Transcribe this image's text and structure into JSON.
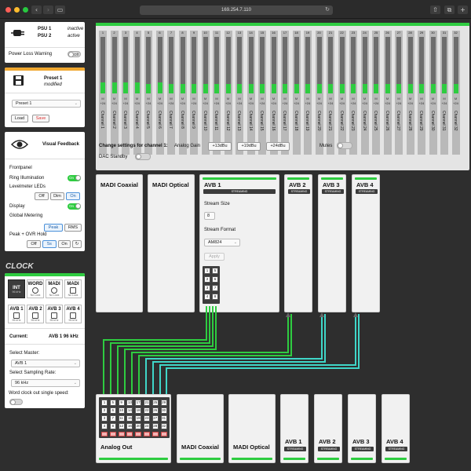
{
  "browser": {
    "url": "169.254.7.110"
  },
  "psu": {
    "items": [
      {
        "label": "PSU 1",
        "status": "inactive"
      },
      {
        "label": "PSU 2",
        "status": "active"
      }
    ],
    "power_loss_label": "Power Loss Warning",
    "power_loss_toggle": "Off"
  },
  "preset": {
    "name": "Preset 1",
    "status": "modified",
    "select_value": "Preset 1",
    "load_label": "Load",
    "save_label": "Save"
  },
  "visual_feedback": {
    "title": "Visual Feedback",
    "frontpanel_label": "Frontpanel",
    "ring_label": "Ring Illumination",
    "ring_toggle": "On",
    "levelmeter_label": "Levelmeter LEDs",
    "levelmeter_options": [
      "Off",
      "Dim",
      "On"
    ],
    "display_label": "Display",
    "display_toggle": "On",
    "global_metering_label": "Global Metering",
    "metering_options": [
      "Peak",
      "RMS"
    ],
    "peak_hold_label": "Peak + OVR Hold",
    "peak_hold_options": [
      "Off",
      "5s",
      "On",
      "↻"
    ]
  },
  "clock": {
    "title": "CLOCK",
    "sources_top": [
      {
        "name": "INT",
        "status": "96 kHz"
      },
      {
        "name": "WORD",
        "status": "No Lock"
      },
      {
        "name": "MADI",
        "status": "No Lock"
      },
      {
        "name": "MADI",
        "status": "No Lock"
      }
    ],
    "sources_bottom": [
      {
        "name": "AVB 1",
        "status": "96 kHz"
      },
      {
        "name": "AVB 2",
        "status": "96 kHz"
      },
      {
        "name": "AVB 3",
        "status": "96 kHz"
      },
      {
        "name": "AVB 4",
        "status": "96 kHz"
      }
    ],
    "current_label": "Current:",
    "current_value": "AVB 1 96 kHz",
    "master_label": "Select Master:",
    "master_value": "AVB 1",
    "rate_label": "Select Sampling Rate:",
    "rate_value": "96 kHz",
    "wordclock_label": "Word clock out single speed:"
  },
  "mixer": {
    "channels": [
      {
        "num": "1",
        "gain": "+24",
        "name": "Channel 1"
      },
      {
        "num": "2",
        "gain": "+24",
        "name": "Channel 2"
      },
      {
        "num": "3",
        "gain": "+24",
        "name": "Channel 3"
      },
      {
        "num": "4",
        "gain": "+24",
        "name": "Channel 4"
      },
      {
        "num": "5",
        "gain": "+24",
        "name": "Channel 5"
      },
      {
        "num": "6",
        "gain": "+24",
        "name": "Channel 6"
      },
      {
        "num": "7",
        "gain": "+24",
        "name": "Channel 7"
      },
      {
        "num": "8",
        "gain": "+24",
        "name": "Channel 8"
      },
      {
        "num": "9",
        "gain": "+24",
        "name": "Channel 9"
      },
      {
        "num": "10",
        "gain": "+24",
        "name": "Channel 10"
      },
      {
        "num": "11",
        "gain": "+24",
        "name": "Channel 11"
      },
      {
        "num": "12",
        "gain": "+24",
        "name": "Channel 12"
      },
      {
        "num": "13",
        "gain": "+24",
        "name": "Channel 13"
      },
      {
        "num": "14",
        "gain": "+24",
        "name": "Channel 14"
      },
      {
        "num": "15",
        "gain": "+24",
        "name": "Channel 15"
      },
      {
        "num": "16",
        "gain": "+24",
        "name": "Channel 16"
      },
      {
        "num": "17",
        "gain": "+24",
        "name": "Channel 17"
      },
      {
        "num": "18",
        "gain": "+24",
        "name": "Channel 18"
      },
      {
        "num": "19",
        "gain": "+24",
        "name": "Channel 19"
      },
      {
        "num": "20",
        "gain": "+24",
        "name": "Channel 20"
      },
      {
        "num": "21",
        "gain": "+24",
        "name": "Channel 21"
      },
      {
        "num": "22",
        "gain": "+24",
        "name": "Channel 22"
      },
      {
        "num": "23",
        "gain": "+24",
        "name": "Channel 23"
      },
      {
        "num": "24",
        "gain": "+24",
        "name": "Channel 24"
      },
      {
        "num": "25",
        "gain": "+24",
        "name": "Channel 25"
      },
      {
        "num": "26",
        "gain": "+24",
        "name": "Channel 26"
      },
      {
        "num": "27",
        "gain": "+24",
        "name": "Channel 27"
      },
      {
        "num": "28",
        "gain": "+24",
        "name": "Channel 28"
      },
      {
        "num": "29",
        "gain": "+24",
        "name": "Channel 29"
      },
      {
        "num": "30",
        "gain": "+24",
        "name": "Channel 30"
      },
      {
        "num": "31",
        "gain": "+24",
        "name": "Channel 31"
      },
      {
        "num": "32",
        "gain": "+24",
        "name": "Channel 32"
      }
    ],
    "mute_marker": "M",
    "change_label": "Change settings for channel 1:",
    "analog_gain_label": "Analog Gain",
    "gain_options": [
      "+13dBu",
      "+19dBu",
      "+24dBu"
    ],
    "mutes_label": "Mutes",
    "dac_label": "DAC Standby"
  },
  "inputs": {
    "madi_coaxial": "MADI Coaxial",
    "madi_optical": "MADI Optical",
    "avb1": {
      "title": "AVB 1",
      "streaming": "STREAMING",
      "stream_size_label": "Stream Size",
      "stream_size_value": "8",
      "stream_format_label": "Stream Format",
      "stream_format_value": "AM824",
      "apply_label": "Apply",
      "slots": [
        "1",
        "5",
        "2",
        "6",
        "3",
        "7",
        "4",
        "8"
      ]
    },
    "avb2": {
      "title": "AVB 2",
      "streaming": "STREAMING"
    },
    "avb3": {
      "title": "AVB 3",
      "streaming": "STREAMING"
    },
    "avb4": {
      "title": "AVB 4",
      "streaming": "STREAMING"
    }
  },
  "outputs": {
    "analog_out": "Analog Out",
    "grid": [
      "1",
      "5",
      "9",
      "13",
      "17",
      "21",
      "25",
      "29",
      "2",
      "6",
      "10",
      "14",
      "18",
      "22",
      "26",
      "30",
      "3",
      "7",
      "11",
      "15",
      "19",
      "23",
      "27",
      "31",
      "4",
      "8",
      "12",
      "16",
      "20",
      "24",
      "28",
      "32"
    ],
    "madi_coaxial": "MADI Coaxial",
    "madi_optical": "MADI Optical",
    "avb": [
      {
        "title": "AVB 1",
        "streaming": "STREAMING"
      },
      {
        "title": "AVB 2",
        "streaming": "STREAMING"
      },
      {
        "title": "AVB 3",
        "streaming": "STREAMING"
      },
      {
        "title": "AVB 4",
        "streaming": "STREAMING"
      }
    ]
  },
  "colors": {
    "accent_green": "#2ecc40",
    "wire_teal": "#3fd6c8",
    "preset_orange": "#f0a830"
  }
}
